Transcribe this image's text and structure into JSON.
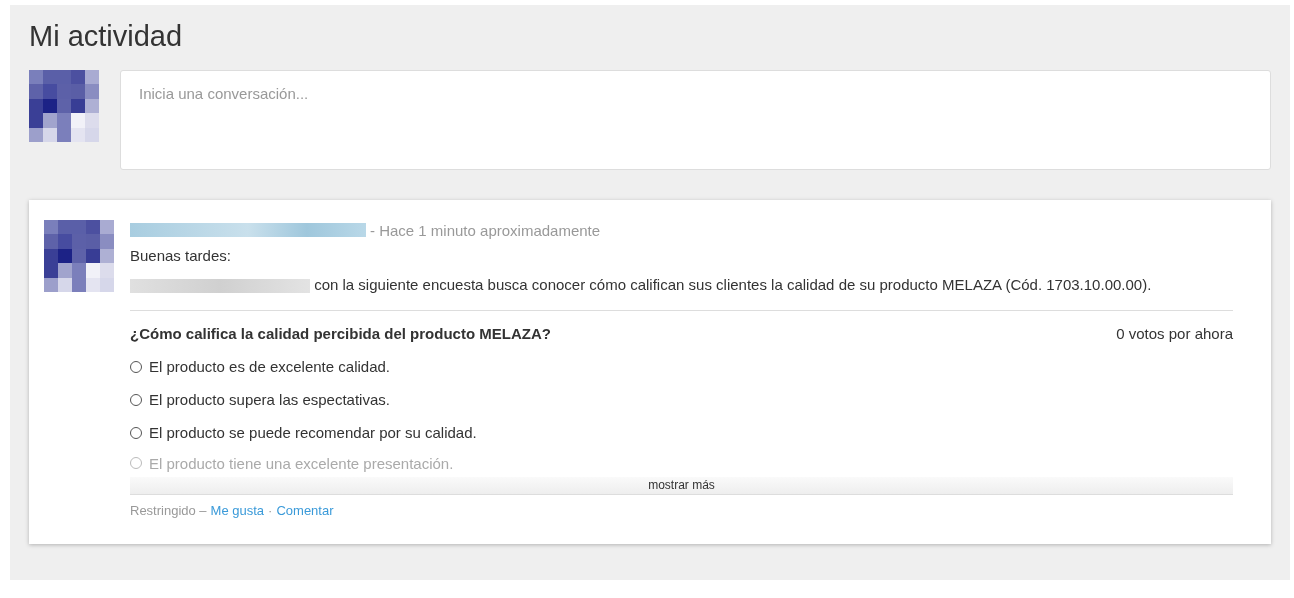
{
  "page": {
    "title": "Mi actividad"
  },
  "composer": {
    "placeholder": "Inicia una conversación..."
  },
  "post": {
    "time": "- Hace 1 minuto aproximadamente",
    "greeting": "Buenas tardes:",
    "body": "con la siguiente encuesta busca conocer cómo califican sus clientes la calidad de su producto MELAZA (Cód. 1703.10.00.00).",
    "poll": {
      "question": "¿Cómo califica la calidad percibida del producto MELAZA?",
      "votes": "0 votos por ahora",
      "options": [
        {
          "label": "El producto es de excelente calidad.",
          "selected": false,
          "faded": false
        },
        {
          "label": "El producto supera las espectativas.",
          "selected": false,
          "faded": false
        },
        {
          "label": "El producto se puede recomendar por su calidad.",
          "selected": false,
          "faded": false
        },
        {
          "label": "El producto tiene una excelente presentación.",
          "selected": false,
          "faded": true
        }
      ],
      "more": "mostrar más"
    },
    "footer": {
      "visibility": "Restringido –",
      "like": "Me gusta",
      "separator": "·",
      "comment": "Comentar"
    }
  }
}
